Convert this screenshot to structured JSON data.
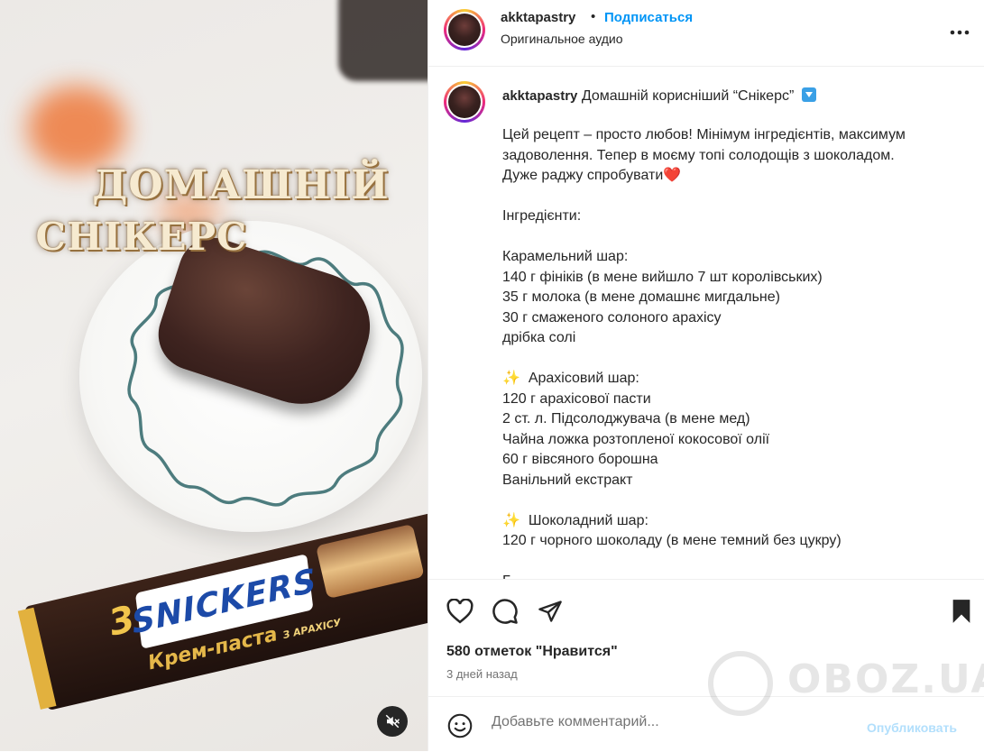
{
  "media": {
    "overlay_title_line1": "ДОМАШНІЙ",
    "overlay_title_line2": "СНІКЕРС",
    "candy_brand": "SNICKERS",
    "candy_count": "3",
    "candy_flavor": "Крем-паста",
    "candy_flavor_sub": "З АРАХІСУ",
    "mute_icon": "speaker-muted-icon"
  },
  "header": {
    "username": "akktapastry",
    "separator": "•",
    "follow_label": "Подписаться",
    "audio_label": "Оригинальное аудио",
    "more_icon": "more-horizontal-icon"
  },
  "caption": {
    "username": "akktapastry",
    "title": "Домашній корисніший “Снікерс”",
    "lines": [
      "Цей рецепт – просто любов! Мінімум інгредієнтів, максимум",
      "задоволення. Тепер в моєму топі солодощів з шоколадом.",
      "Дуже раджу спробувати",
      "",
      "Інгредієнти:",
      "",
      "Карамельний шар:",
      "140 г фініків (в мене вийшло 7 шт королівських)",
      "35 г молока (в мене домашнє мигдальне)",
      "30 г смаженого солоного арахісу",
      "дрібка солі",
      "",
      "Арахісовий шар:",
      "120 г арахісової пасти",
      "2 ст. л. Підсолоджувача (в мене мед)",
      "Чайна ложка розтопленої кокосової олії",
      "60 г вівсяного борошна",
      "Ванільний екстракт",
      "",
      "Шоколадний шар:",
      "120 г чорного шоколаду (в мене темний без цукру)",
      "",
      "Г"
    ],
    "heart_emoji": "❤️",
    "sparkle_emoji": "✨"
  },
  "actions": {
    "like_icon": "heart-outline-icon",
    "comment_icon": "comment-bubble-icon",
    "share_icon": "paper-plane-icon",
    "save_icon": "bookmark-filled-icon",
    "likes_text": "580 отметок \"Нравится\"",
    "date_text": "3 дней назад"
  },
  "comment": {
    "emoji_icon": "smiley-icon",
    "placeholder": "Добавьте комментарий...",
    "publish_label": "Опубликовать"
  },
  "watermark": {
    "text": "OBOZ.UA"
  },
  "colors": {
    "accent_blue": "#0095f6",
    "publish_disabled": "#b2dffc",
    "text": "#262626",
    "muted": "#737373"
  }
}
